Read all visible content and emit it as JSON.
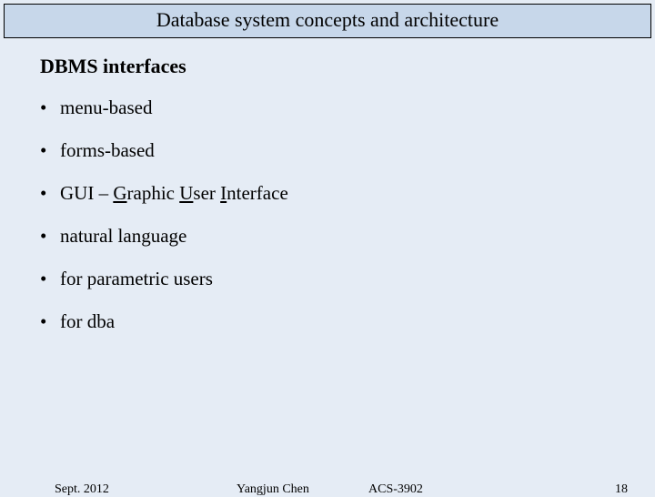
{
  "title": "Database system concepts and architecture",
  "heading": "DBMS interfaces",
  "bullets": {
    "b0": "menu-based",
    "b1": "forms-based",
    "b2_pre": "GUI – ",
    "b2_g": "G",
    "b2_mid1": "raphic ",
    "b2_u": "U",
    "b2_mid2": "ser ",
    "b2_i": "I",
    "b2_post": "nterface",
    "b3": "natural language",
    "b4": "for parametric users",
    "b5": "for dba"
  },
  "footer": {
    "date": "Sept. 2012",
    "author": "Yangjun Chen",
    "course": "ACS-3902",
    "page": "18"
  },
  "dot": "•"
}
